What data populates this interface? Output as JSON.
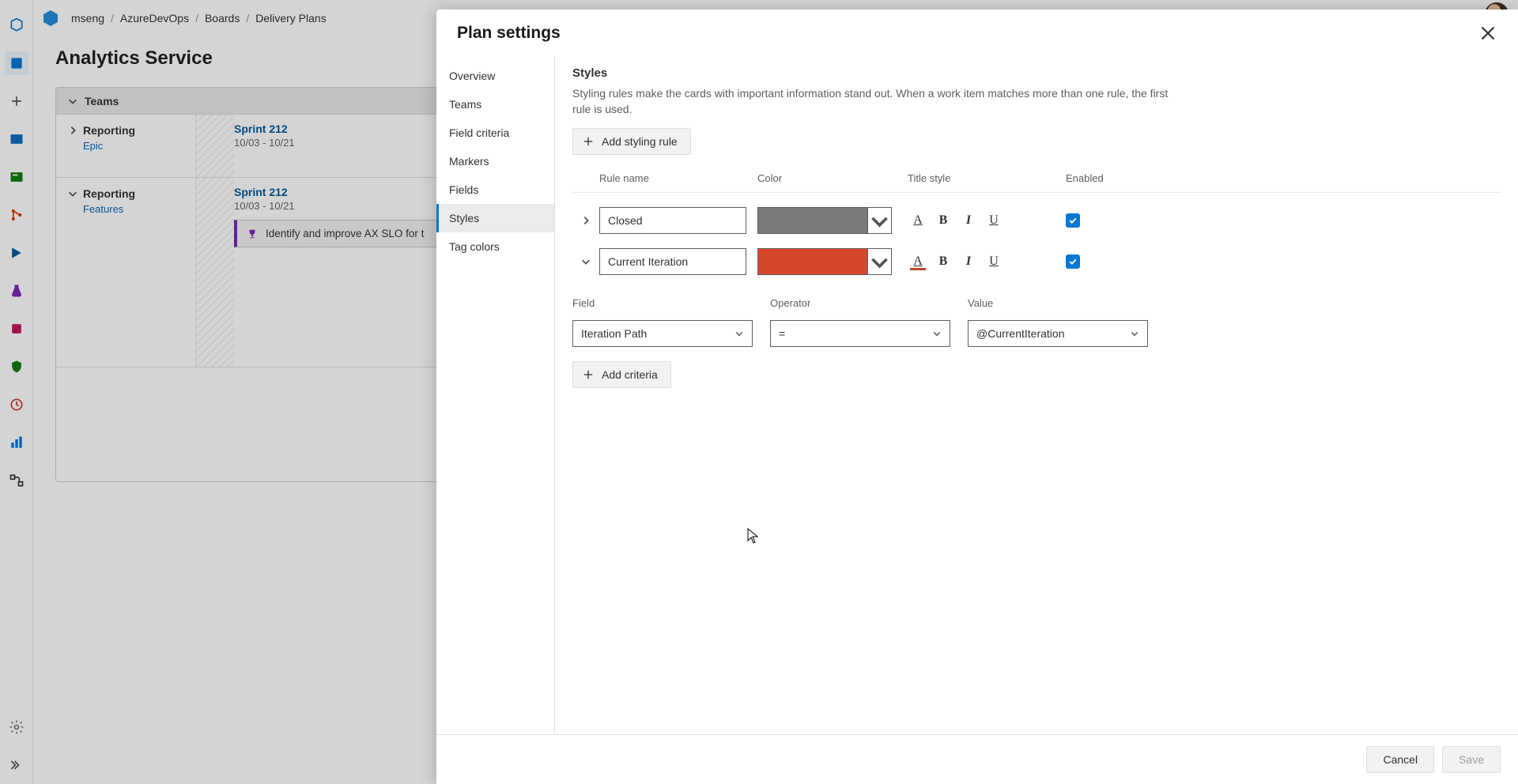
{
  "breadcrumbs": {
    "a": "mseng",
    "b": "AzureDevOps",
    "c": "Boards",
    "d": "Delivery Plans"
  },
  "page": {
    "title": "Analytics Service"
  },
  "lane_header": {
    "title": "Teams"
  },
  "tracks": [
    {
      "name": "Reporting",
      "type": "Epic",
      "sprint": "Sprint 212",
      "dates": "10/03 - 10/21"
    },
    {
      "name": "Reporting",
      "type": "Features",
      "sprint": "Sprint 212",
      "dates": "10/03 - 10/21",
      "card": "Identify and improve AX SLO for t"
    }
  ],
  "dialog": {
    "title": "Plan settings",
    "nav": {
      "overview": "Overview",
      "teams": "Teams",
      "field_criteria": "Field criteria",
      "markers": "Markers",
      "fields": "Fields",
      "styles": "Styles",
      "tag_colors": "Tag colors"
    },
    "section_title": "Styles",
    "section_desc": "Styling rules make the cards with important information stand out. When a work item matches more than one rule, the first rule is used.",
    "add_rule_label": "Add styling rule",
    "headers": {
      "name": "Rule name",
      "color": "Color",
      "title": "Title style",
      "enabled": "Enabled"
    },
    "rules": [
      {
        "name": "Closed",
        "color": "#7a7a7a",
        "font_red": false
      },
      {
        "name": "Current Iteration",
        "color": "#d7472c",
        "font_red": true
      }
    ],
    "criteria_headers": {
      "field": "Field",
      "operator": "Operator",
      "value": "Value"
    },
    "criteria": {
      "field": "Iteration Path",
      "operator": "=",
      "value": "@CurrentIteration"
    },
    "add_criteria_label": "Add criteria",
    "cancel": "Cancel",
    "save": "Save"
  },
  "rail_icons": [
    "project",
    "plus",
    "board",
    "work",
    "branch",
    "test-plan",
    "test",
    "artifacts",
    "shield",
    "retro",
    "stats",
    "flow"
  ],
  "colors": {
    "brand": "#0078d4"
  }
}
